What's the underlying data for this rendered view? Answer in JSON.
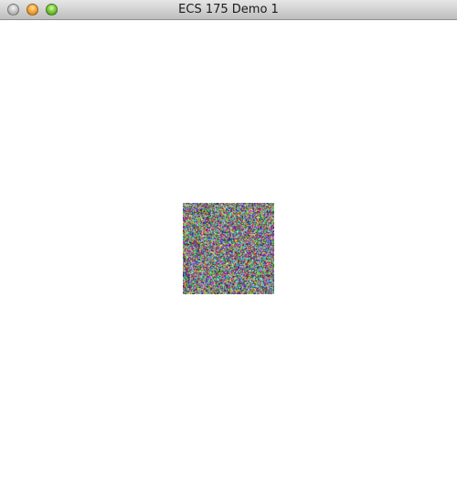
{
  "window": {
    "title": "ECS 175 Demo 1"
  },
  "canvas": {
    "content": "random-color-noise-square",
    "background_color": "#ffffff"
  }
}
